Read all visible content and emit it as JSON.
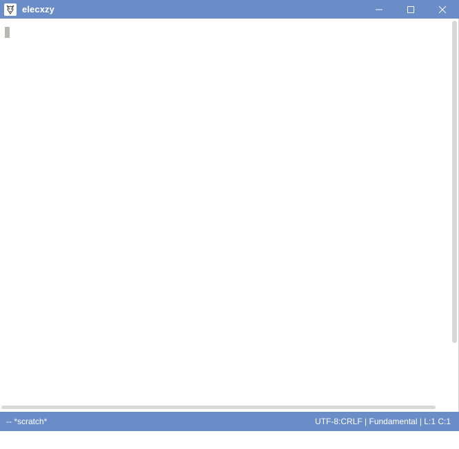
{
  "window": {
    "title": "elecxzy"
  },
  "titlebar_buttons": {
    "minimize_icon": "minimize-icon",
    "maximize_icon": "maximize-icon",
    "close_icon": "close-icon"
  },
  "modeline": {
    "left": "-- *scratch*",
    "right": "UTF-8:CRLF | Fundamental | L:1 C:1"
  },
  "colors": {
    "titlebar": "#6a8cc7",
    "modeline": "#6a8cc7",
    "cursor": "#b8b8b0"
  }
}
